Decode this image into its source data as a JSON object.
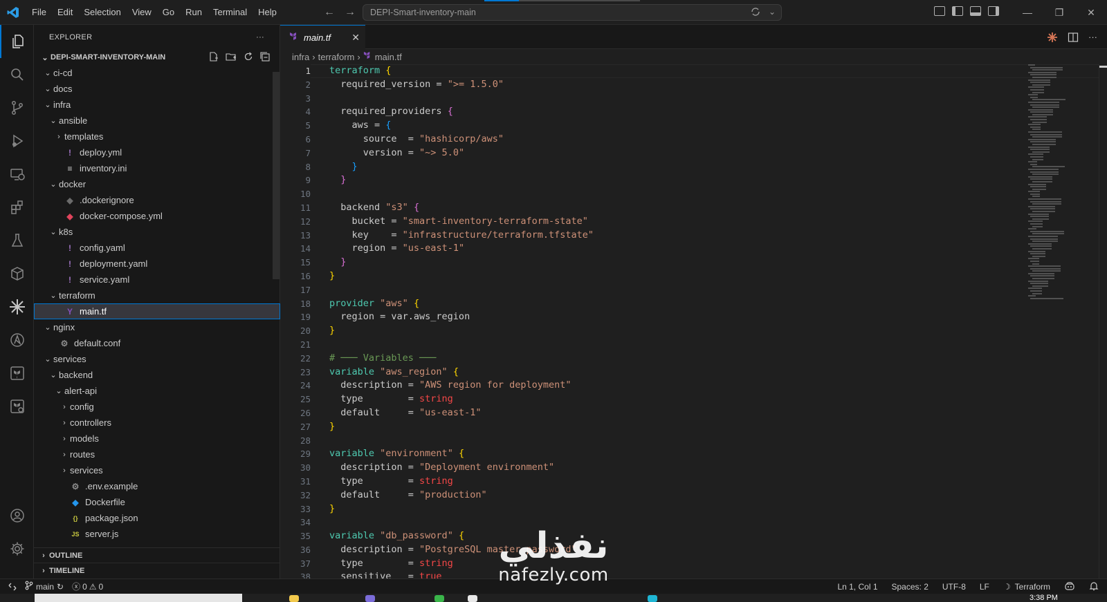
{
  "titlebar": {
    "menu": [
      "File",
      "Edit",
      "Selection",
      "View",
      "Go",
      "Run",
      "Terminal",
      "Help"
    ],
    "command_center": "DEPI-Smart-inventory-main",
    "accent": "#0078d4"
  },
  "activity_bar": {
    "icons": [
      "explorer-icon",
      "search-icon",
      "source-control-icon",
      "run-debug-icon",
      "remote-explorer-icon",
      "extensions-icon",
      "testing-icon",
      "containers-icon",
      "claude-icon",
      "ansible-icon",
      "terraform-icon",
      "terraform-cloud-icon",
      "account-icon",
      "settings-gear-icon"
    ]
  },
  "sidebar": {
    "title": "EXPLORER",
    "more": "···",
    "root": "DEPI-SMART-INVENTORY-MAIN",
    "tree": [
      {
        "label": "ci-cd",
        "depth": 1,
        "kind": "folder-open"
      },
      {
        "label": "docs",
        "depth": 1,
        "kind": "folder-open"
      },
      {
        "label": "infra",
        "depth": 1,
        "kind": "folder-open"
      },
      {
        "label": "ansible",
        "depth": 2,
        "kind": "folder-open"
      },
      {
        "label": "templates",
        "depth": 3,
        "kind": "folder-closed"
      },
      {
        "label": "deploy.yml",
        "depth": 3,
        "kind": "yaml"
      },
      {
        "label": "inventory.ini",
        "depth": 3,
        "kind": "ini"
      },
      {
        "label": "docker",
        "depth": 2,
        "kind": "folder-open"
      },
      {
        "label": ".dockerignore",
        "depth": 3,
        "kind": "dockerignore"
      },
      {
        "label": "docker-compose.yml",
        "depth": 3,
        "kind": "compose"
      },
      {
        "label": "k8s",
        "depth": 2,
        "kind": "folder-open"
      },
      {
        "label": "config.yaml",
        "depth": 3,
        "kind": "yaml"
      },
      {
        "label": "deployment.yaml",
        "depth": 3,
        "kind": "yaml"
      },
      {
        "label": "service.yaml",
        "depth": 3,
        "kind": "yaml"
      },
      {
        "label": "terraform",
        "depth": 2,
        "kind": "folder-open"
      },
      {
        "label": "main.tf",
        "depth": 3,
        "kind": "terraform",
        "selected": true
      },
      {
        "label": "nginx",
        "depth": 1,
        "kind": "folder-open"
      },
      {
        "label": "default.conf",
        "depth": 2,
        "kind": "gear"
      },
      {
        "label": "services",
        "depth": 1,
        "kind": "folder-open"
      },
      {
        "label": "backend",
        "depth": 2,
        "kind": "folder-open"
      },
      {
        "label": "alert-api",
        "depth": 3,
        "kind": "folder-open"
      },
      {
        "label": "config",
        "depth": 4,
        "kind": "folder-closed"
      },
      {
        "label": "controllers",
        "depth": 4,
        "kind": "folder-closed"
      },
      {
        "label": "models",
        "depth": 4,
        "kind": "folder-closed"
      },
      {
        "label": "routes",
        "depth": 4,
        "kind": "folder-closed"
      },
      {
        "label": "services",
        "depth": 4,
        "kind": "folder-closed"
      },
      {
        "label": ".env.example",
        "depth": 4,
        "kind": "gear"
      },
      {
        "label": "Dockerfile",
        "depth": 4,
        "kind": "docker"
      },
      {
        "label": "package.json",
        "depth": 4,
        "kind": "json"
      },
      {
        "label": "server.js",
        "depth": 4,
        "kind": "js"
      }
    ],
    "sections": [
      "OUTLINE",
      "TIMELINE"
    ]
  },
  "editor": {
    "tab_label": "main.tf",
    "breadcrumb": [
      "infra",
      "terraform",
      "main.tf"
    ],
    "current_line": 1,
    "lines": [
      [
        [
          "terraform",
          "key"
        ],
        [
          " ",
          ""
        ],
        [
          "{",
          "b1"
        ]
      ],
      [
        [
          "  required_version = ",
          "prop"
        ],
        [
          "\">= 1.5.0\"",
          "str"
        ]
      ],
      [],
      [
        [
          "  required_providers ",
          "prop"
        ],
        [
          "{",
          "b2"
        ]
      ],
      [
        [
          "    aws = ",
          "prop"
        ],
        [
          "{",
          "b3"
        ]
      ],
      [
        [
          "      source  = ",
          "prop"
        ],
        [
          "\"hashicorp/aws\"",
          "str"
        ]
      ],
      [
        [
          "      version = ",
          "prop"
        ],
        [
          "\"~> 5.0\"",
          "str"
        ]
      ],
      [
        [
          "    ",
          ""
        ],
        [
          "}",
          "b3"
        ]
      ],
      [
        [
          "  ",
          ""
        ],
        [
          "}",
          "b2"
        ]
      ],
      [],
      [
        [
          "  backend ",
          "prop"
        ],
        [
          "\"s3\"",
          "str"
        ],
        [
          " ",
          ""
        ],
        [
          "{",
          "b2"
        ]
      ],
      [
        [
          "    bucket = ",
          "prop"
        ],
        [
          "\"smart-inventory-terraform-state\"",
          "str"
        ]
      ],
      [
        [
          "    key    = ",
          "prop"
        ],
        [
          "\"infrastructure/terraform.tfstate\"",
          "str"
        ]
      ],
      [
        [
          "    region = ",
          "prop"
        ],
        [
          "\"us-east-1\"",
          "str"
        ]
      ],
      [
        [
          "  ",
          ""
        ],
        [
          "}",
          "b2"
        ]
      ],
      [
        [
          "}",
          "b1"
        ]
      ],
      [],
      [
        [
          "provider ",
          "key"
        ],
        [
          "\"aws\"",
          "str"
        ],
        [
          " ",
          ""
        ],
        [
          "{",
          "b1"
        ]
      ],
      [
        [
          "  region = var.aws_region",
          "prop"
        ]
      ],
      [
        [
          "}",
          "b1"
        ]
      ],
      [],
      [
        [
          "# ─── Variables ───",
          "com"
        ]
      ],
      [
        [
          "variable ",
          "key"
        ],
        [
          "\"aws_region\"",
          "str"
        ],
        [
          " ",
          ""
        ],
        [
          "{",
          "b1"
        ]
      ],
      [
        [
          "  description = ",
          "prop"
        ],
        [
          "\"AWS region for deployment\"",
          "str"
        ]
      ],
      [
        [
          "  type        = ",
          "prop"
        ],
        [
          "string",
          "type"
        ]
      ],
      [
        [
          "  default     = ",
          "prop"
        ],
        [
          "\"us-east-1\"",
          "str"
        ]
      ],
      [
        [
          "}",
          "b1"
        ]
      ],
      [],
      [
        [
          "variable ",
          "key"
        ],
        [
          "\"environment\"",
          "str"
        ],
        [
          " ",
          ""
        ],
        [
          "{",
          "b1"
        ]
      ],
      [
        [
          "  description = ",
          "prop"
        ],
        [
          "\"Deployment environment\"",
          "str"
        ]
      ],
      [
        [
          "  type        = ",
          "prop"
        ],
        [
          "string",
          "type"
        ]
      ],
      [
        [
          "  default     = ",
          "prop"
        ],
        [
          "\"production\"",
          "str"
        ]
      ],
      [
        [
          "}",
          "b1"
        ]
      ],
      [],
      [
        [
          "variable ",
          "key"
        ],
        [
          "\"db_password\"",
          "str"
        ],
        [
          " ",
          ""
        ],
        [
          "{",
          "b1"
        ]
      ],
      [
        [
          "  description = ",
          "prop"
        ],
        [
          "\"PostgreSQL master password\"",
          "str"
        ]
      ],
      [
        [
          "  type        = ",
          "prop"
        ],
        [
          "string",
          "type"
        ]
      ],
      [
        [
          "  sensitive   = ",
          "prop"
        ],
        [
          "true",
          "type"
        ]
      ]
    ]
  },
  "statusbar": {
    "branch": "main",
    "errors": "0",
    "warnings": "0",
    "position": "Ln 1, Col 1",
    "spaces": "Spaces: 2",
    "encoding": "UTF-8",
    "eol": "LF",
    "language": "Terraform"
  },
  "taskbar": {
    "clock": "3:38 PM"
  },
  "watermark": {
    "arabic": "نفذلي",
    "latin": "nafezly.com"
  }
}
